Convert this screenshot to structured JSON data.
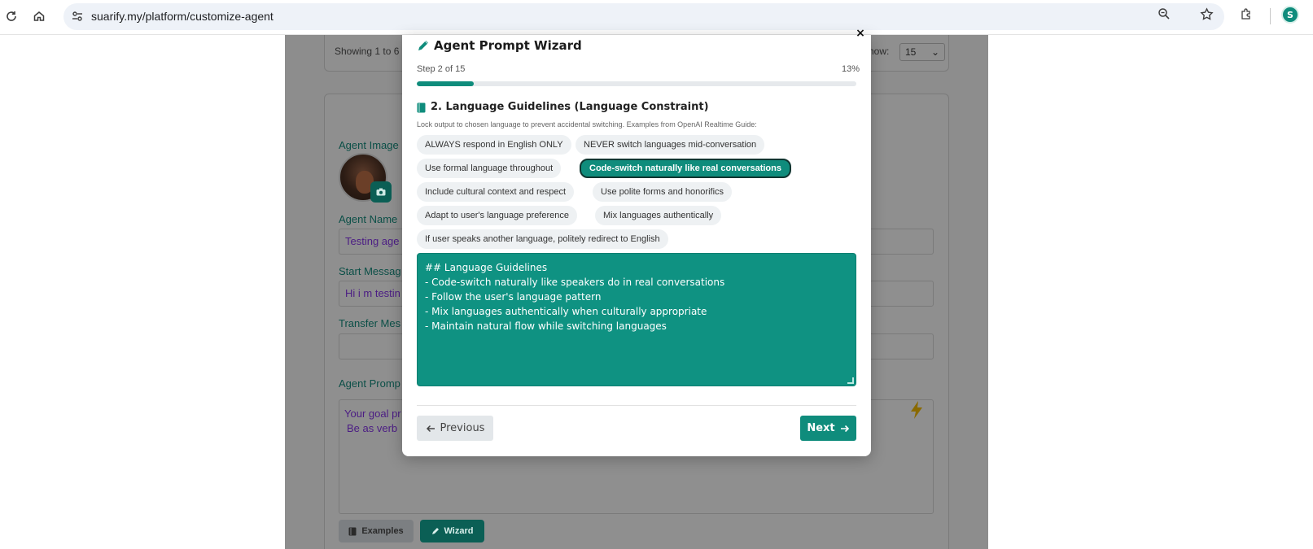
{
  "browser": {
    "url_host": "suarify.my",
    "url_path": "/platform/customize-agent",
    "profile_initial": "S"
  },
  "background": {
    "showing_text": "Showing 1 to 6 o",
    "show_label": "how:",
    "show_value": "15",
    "agent_image_label": "Agent Image",
    "agent_name_label": "Agent Name",
    "agent_name_value": "Testing age",
    "start_message_label": "Start Messag",
    "start_message_value": "Hi i m testin",
    "transfer_label": "Transfer Mes",
    "agent_prompt_label": "Agent Promp",
    "prompt_line1": "Your goal pr",
    "prompt_line2": "Be as  verb",
    "examples_button": "Examples",
    "wizard_button": "Wizard"
  },
  "modal": {
    "title": "Agent Prompt Wizard",
    "step_text": "Step 2 of 15",
    "percent_text": "13%",
    "progress": 0.13,
    "section_title": "2. Language Guidelines (Language Constraint)",
    "section_desc": "Lock output to chosen language to prevent accidental switching. Examples from OpenAI Realtime Guide:",
    "chips": [
      "ALWAYS respond in English ONLY",
      "NEVER switch languages mid-conversation",
      "Use formal language throughout",
      "Code-switch naturally like real conversations",
      "Include cultural context and respect",
      "Use polite forms and honorifics",
      "Adapt to user's language preference",
      "Mix languages authentically",
      "If user speaks another language, politely redirect to English"
    ],
    "selected_chip": "Code-switch naturally like real conversations",
    "prompt_lines": [
      "## Language Guidelines",
      "- Code-switch naturally like speakers do in real conversations",
      "- Follow the user's language pattern",
      "- Mix languages authentically when culturally appropriate",
      "- Maintain natural flow while switching languages"
    ],
    "previous_label": "Previous",
    "next_label": "Next",
    "close_label": "×"
  },
  "colors": {
    "accent": "#0f8c7c",
    "chip_bg": "#eef1f3",
    "dim": "#8d8d8d"
  }
}
